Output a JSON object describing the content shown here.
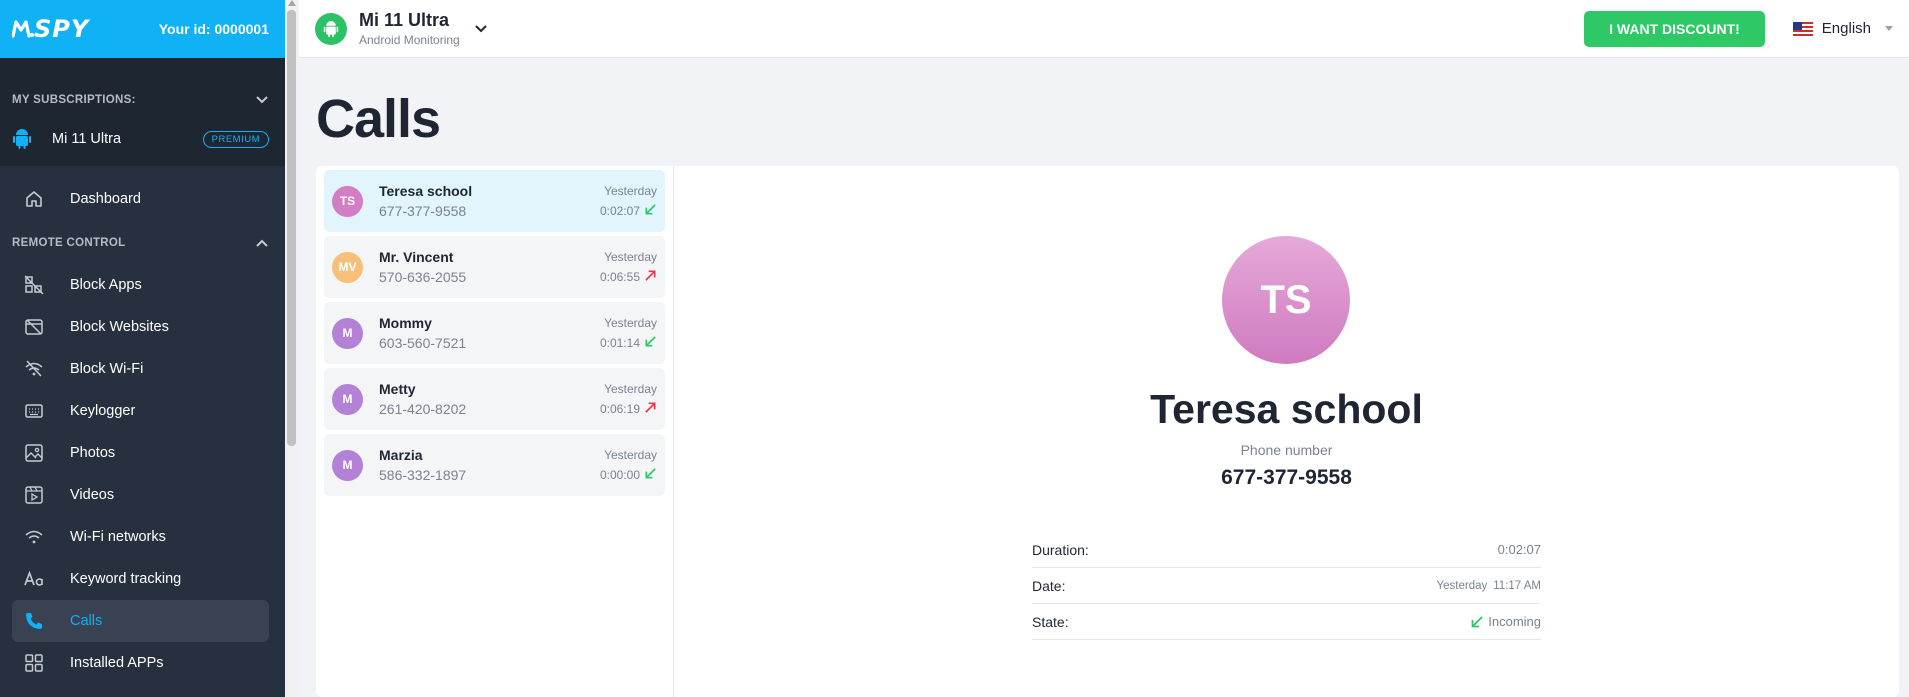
{
  "sidebar": {
    "logo_text": "SPY",
    "your_id": "Your id: 0000001",
    "subscriptions_label": "MY SUBSCRIPTIONS:",
    "device_name": "Mi 11 Ultra",
    "premium_badge": "PREMIUM",
    "dashboard": "Dashboard",
    "remote_control_label": "REMOTE CONTROL",
    "items": [
      {
        "label": "Block Apps",
        "icon": "block-apps-icon"
      },
      {
        "label": "Block Websites",
        "icon": "block-websites-icon"
      },
      {
        "label": "Block Wi-Fi",
        "icon": "block-wifi-icon"
      },
      {
        "label": "Keylogger",
        "icon": "keyboard-icon"
      },
      {
        "label": "Photos",
        "icon": "photo-icon"
      },
      {
        "label": "Videos",
        "icon": "video-icon"
      },
      {
        "label": "Wi-Fi networks",
        "icon": "wifi-icon"
      },
      {
        "label": "Keyword tracking",
        "icon": "text-icon"
      },
      {
        "label": "Calls",
        "icon": "phone-icon",
        "active": true
      },
      {
        "label": "Installed APPs",
        "icon": "apps-icon"
      }
    ]
  },
  "header": {
    "device_title": "Mi 11 Ultra",
    "device_subtitle": "Android Monitoring",
    "discount_button": "I WANT DISCOUNT!",
    "language": "English"
  },
  "main": {
    "title": "Calls",
    "calls": [
      {
        "initials": "TS",
        "name": "Teresa school",
        "number": "677-377-9558",
        "day": "Yesterday",
        "duration": "0:02:07",
        "direction": "incoming",
        "color": "#d27dc4"
      },
      {
        "initials": "MV",
        "name": "Mr. Vincent",
        "number": "570-636-2055",
        "day": "Yesterday",
        "duration": "0:06:55",
        "direction": "outgoing",
        "color": "#f7c07a"
      },
      {
        "initials": "M",
        "name": "Mommy",
        "number": "603-560-7521",
        "day": "Yesterday",
        "duration": "0:01:14",
        "direction": "incoming",
        "color": "#b382d6"
      },
      {
        "initials": "M",
        "name": "Metty",
        "number": "261-420-8202",
        "day": "Yesterday",
        "duration": "0:06:19",
        "direction": "outgoing",
        "color": "#b382d6"
      },
      {
        "initials": "M",
        "name": "Marzia",
        "number": "586-332-1897",
        "day": "Yesterday",
        "duration": "0:00:00",
        "direction": "incoming",
        "color": "#b382d6"
      }
    ],
    "detail": {
      "initials": "TS",
      "name": "Teresa school",
      "phone_label": "Phone number",
      "phone": "677-377-9558",
      "duration_label": "Duration:",
      "duration": "0:02:07",
      "date_label": "Date:",
      "date_day": "Yesterday",
      "date_time": "11:17 AM",
      "state_label": "State:",
      "state": "Incoming"
    }
  },
  "colors": {
    "brand": "#10b1f5",
    "incoming": "#2ec866",
    "outgoing": "#e8364f",
    "discount": "#2ec866"
  }
}
